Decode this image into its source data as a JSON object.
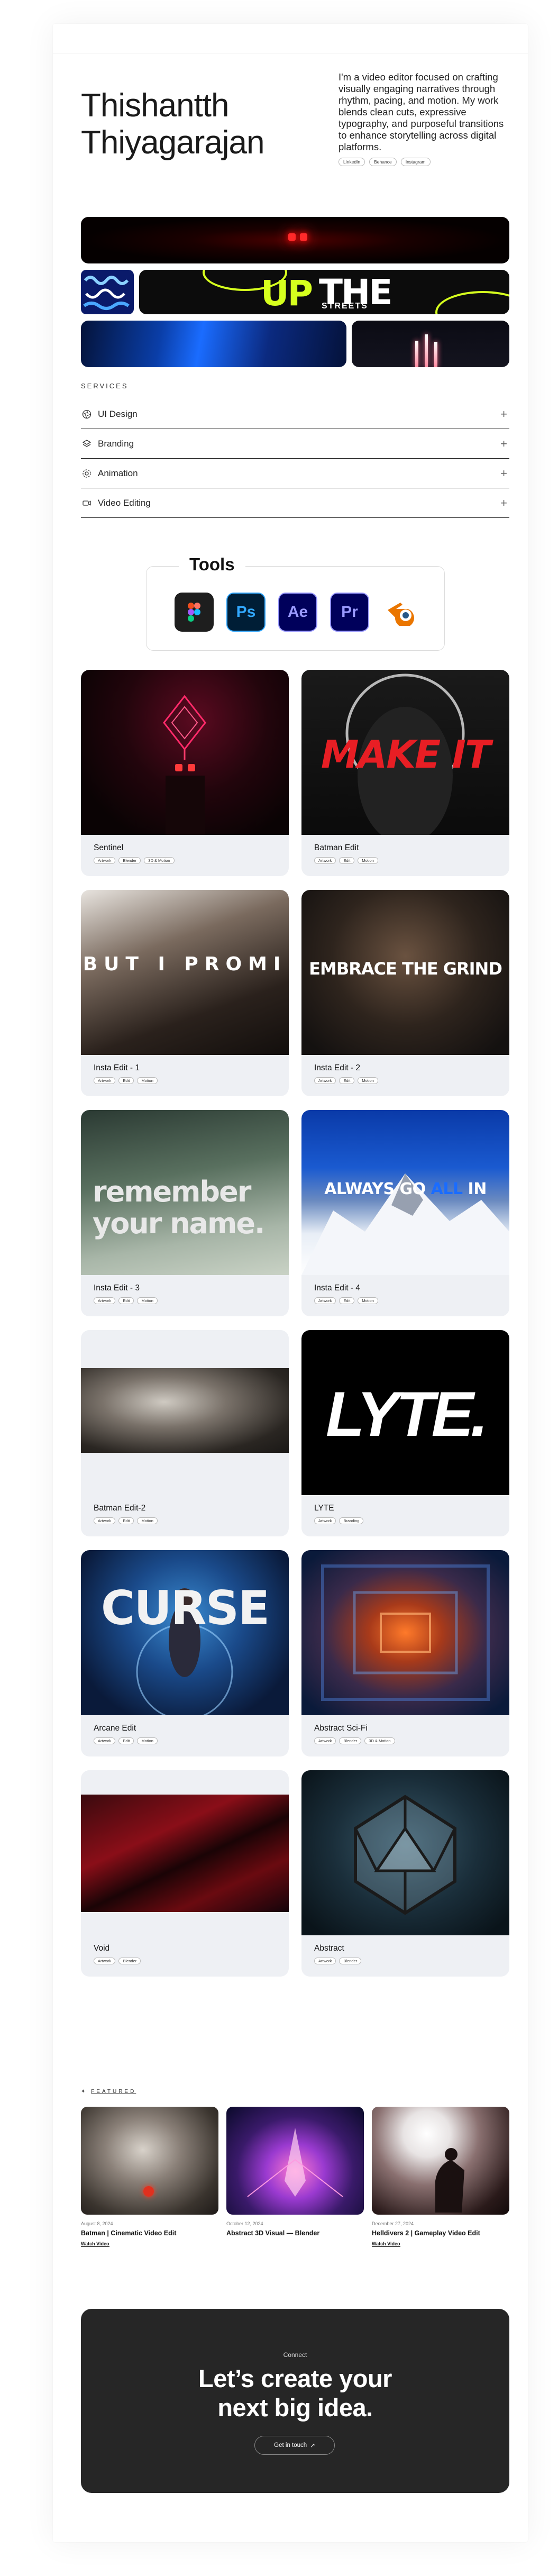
{
  "hero": {
    "name_line1": "Thishantth",
    "name_line2": "Thiyagarajan",
    "bio": "I'm a video editor focused on crafting visually engaging narratives through rhythm, pacing, and motion. My work blends clean cuts, expressive typography, and purposeful transitions to enhance storytelling across digital platforms.",
    "tags": [
      "LinkedIn",
      "Behance",
      "Instagram"
    ]
  },
  "showreel": {
    "big_text_1": "UP",
    "big_text_2": "THE",
    "big_text_3": "STREETS"
  },
  "services": {
    "heading": "SERVICES",
    "items": [
      {
        "label": "UI Design",
        "icon": "aperture-icon"
      },
      {
        "label": "Branding",
        "icon": "layers-icon"
      },
      {
        "label": "Animation",
        "icon": "gear-icon"
      },
      {
        "label": "Video Editing",
        "icon": "film-icon"
      }
    ]
  },
  "tools": {
    "title": "Tools",
    "items": [
      {
        "name": "Figma",
        "abbr": "F",
        "bg": "#1e1e1e",
        "fg": "#f24e1e"
      },
      {
        "name": "Photoshop",
        "abbr": "Ps",
        "bg": "#001e36",
        "fg": "#31a8ff"
      },
      {
        "name": "After Effects",
        "abbr": "Ae",
        "bg": "#00005b",
        "fg": "#9999ff"
      },
      {
        "name": "Premiere Pro",
        "abbr": "Pr",
        "bg": "#00005b",
        "fg": "#9999ff"
      },
      {
        "name": "Blender",
        "abbr": "",
        "bg": "#ffffff",
        "fg": "#ea7600"
      }
    ]
  },
  "projects": [
    {
      "title": "Sentinel",
      "tags": [
        "Artwork",
        "Blender",
        "3D & Motion"
      ]
    },
    {
      "title": "Batman Edit",
      "tags": [
        "Artwork",
        "Edit",
        "Motion"
      ],
      "overlay": "MAKE IT"
    },
    {
      "title": "Insta Edit - 1",
      "tags": [
        "Artwork",
        "Edit",
        "Motion"
      ],
      "overlay": "BUT I PROMI"
    },
    {
      "title": "Insta Edit - 2",
      "tags": [
        "Artwork",
        "Edit",
        "Motion"
      ],
      "overlay": "EMBRACE THE GRIND"
    },
    {
      "title": "Insta Edit - 3",
      "tags": [
        "Artwork",
        "Edit",
        "Motion"
      ],
      "overlay": "remember your name."
    },
    {
      "title": "Insta Edit - 4",
      "tags": [
        "Artwork",
        "Edit",
        "Motion"
      ],
      "overlay_a": "ALWAYS GO ",
      "overlay_b": "ALL",
      "overlay_c": " IN"
    },
    {
      "title": "Batman Edit-2",
      "tags": [
        "Artwork",
        "Edit",
        "Motion"
      ]
    },
    {
      "title": "LYTE",
      "tags": [
        "Artwork",
        "Branding"
      ],
      "overlay": "LYTE."
    },
    {
      "title": "Arcane Edit",
      "tags": [
        "Artwork",
        "Edit",
        "Motion"
      ],
      "overlay": "CURSE"
    },
    {
      "title": "Abstract Sci-Fi",
      "tags": [
        "Artwork",
        "Blender",
        "3D & Motion"
      ]
    },
    {
      "title": "Void",
      "tags": [
        "Artwork",
        "Blender"
      ]
    },
    {
      "title": "Abstract",
      "tags": [
        "Artwork",
        "Blender"
      ]
    }
  ],
  "featured": {
    "label": "FEATURED",
    "items": [
      {
        "date": "August 8, 2024",
        "title": "Batman | Cinematic Video Edit",
        "link": "Watch Video"
      },
      {
        "date": "October 12, 2024",
        "title": "Abstract 3D Visual — Blender",
        "link": ""
      },
      {
        "date": "December 27, 2024",
        "title": "Helldivers 2 | Gameplay Video Edit",
        "link": "Watch Video"
      }
    ]
  },
  "cta": {
    "kicker": "Connect",
    "headline_1": "Let’s create your",
    "headline_2": "next big idea.",
    "button": "Get in touch",
    "button_icon": "arrow-up-right-icon"
  }
}
